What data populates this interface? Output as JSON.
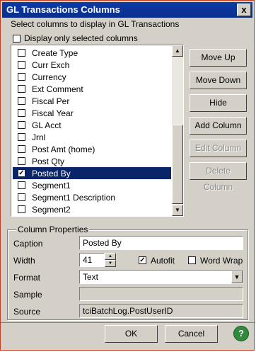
{
  "window": {
    "title": "GL Transactions Columns",
    "close_glyph": "x"
  },
  "subtitle": "Select columns to display in GL Transactions",
  "display_only_selected": {
    "label": "Display only selected columns",
    "checked": false
  },
  "columns": [
    {
      "label": "Create Type",
      "checked": false,
      "selected": false
    },
    {
      "label": "Curr Exch",
      "checked": false,
      "selected": false
    },
    {
      "label": "Currency",
      "checked": false,
      "selected": false
    },
    {
      "label": "Ext Comment",
      "checked": false,
      "selected": false
    },
    {
      "label": "Fiscal Per",
      "checked": false,
      "selected": false
    },
    {
      "label": "Fiscal Year",
      "checked": false,
      "selected": false
    },
    {
      "label": "GL Acct",
      "checked": false,
      "selected": false
    },
    {
      "label": "Jrnl",
      "checked": false,
      "selected": false
    },
    {
      "label": "Post Amt (home)",
      "checked": false,
      "selected": false
    },
    {
      "label": "Post Qty",
      "checked": false,
      "selected": false
    },
    {
      "label": "Posted By",
      "checked": true,
      "selected": true
    },
    {
      "label": "Segment1",
      "checked": false,
      "selected": false
    },
    {
      "label": "Segment1 Description",
      "checked": false,
      "selected": false
    },
    {
      "label": "Segment2",
      "checked": false,
      "selected": false
    }
  ],
  "buttons": {
    "move_up": "Move Up",
    "move_down": "Move Down",
    "hide": "Hide",
    "add_column": "Add Column",
    "edit_column": "Edit Column",
    "delete_column": "Delete Column"
  },
  "properties": {
    "group_title": "Column Properties",
    "caption_label": "Caption",
    "caption_value": "Posted By",
    "width_label": "Width",
    "width_value": "41",
    "autofit_label": "Autofit",
    "autofit_checked": true,
    "wordwrap_label": "Word Wrap",
    "wordwrap_checked": false,
    "format_label": "Format",
    "format_value": "Text",
    "sample_label": "Sample",
    "sample_value": "",
    "source_label": "Source",
    "source_value": "tciBatchLog.PostUserID"
  },
  "footer": {
    "ok": "OK",
    "cancel": "Cancel",
    "help_glyph": "?"
  },
  "colors": {
    "title_bar": "#0c3aa8",
    "selection": "#0a246a",
    "help": "#2f8a3b"
  }
}
